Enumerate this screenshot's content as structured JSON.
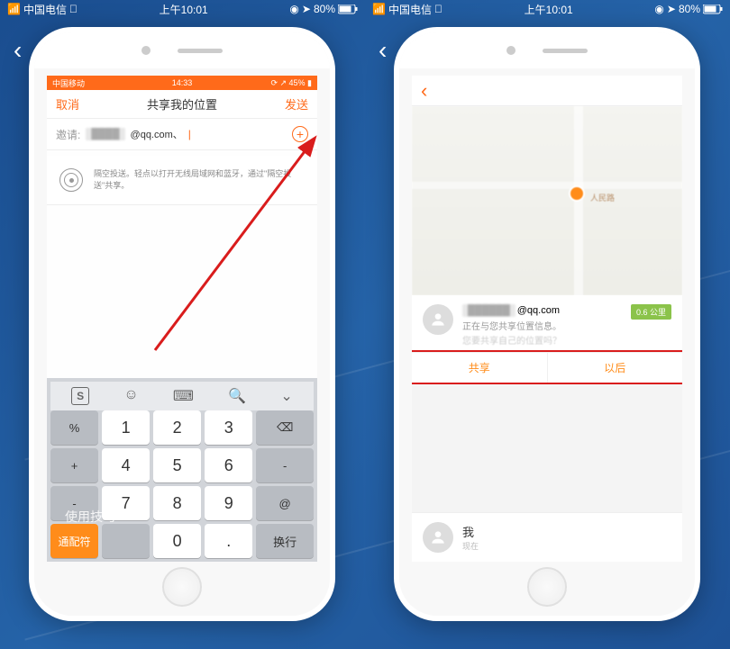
{
  "outerStatus": {
    "carrier": "中国电信",
    "time": "上午10:01",
    "battery": "80%"
  },
  "leftPhone": {
    "innerStatus": {
      "carrier": "中国移动",
      "time": "14:33",
      "battery": "45%"
    },
    "nav": {
      "cancel": "取消",
      "title": "共享我的位置",
      "send": "发送"
    },
    "invite": {
      "label": "邀请:",
      "suffix": "@qq.com、"
    },
    "airdrop": "隔空投送。轻点以打开无线局域网和蓝牙，通过\"隔空投送\"共享。",
    "keyboard": {
      "rows": [
        [
          "%",
          "1",
          "2",
          "3",
          "⌫"
        ],
        [
          "+",
          "4",
          "5",
          "6",
          "-"
        ],
        [
          "-",
          "7",
          "8",
          "9",
          "@"
        ],
        [
          "通配符",
          "",
          "0",
          ".",
          "换行"
        ]
      ]
    },
    "watermark": "使用技巧"
  },
  "rightPhone": {
    "map": {
      "label": "人民路"
    },
    "contact": {
      "emailSuffix": "@qq.com",
      "status": "正在与您共享位置信息。",
      "prompt": "您要共享自己的位置吗？",
      "distance": "0.6 公里"
    },
    "actions": {
      "share": "共享",
      "later": "以后"
    },
    "me": {
      "name": "我",
      "sub": "现在"
    }
  }
}
